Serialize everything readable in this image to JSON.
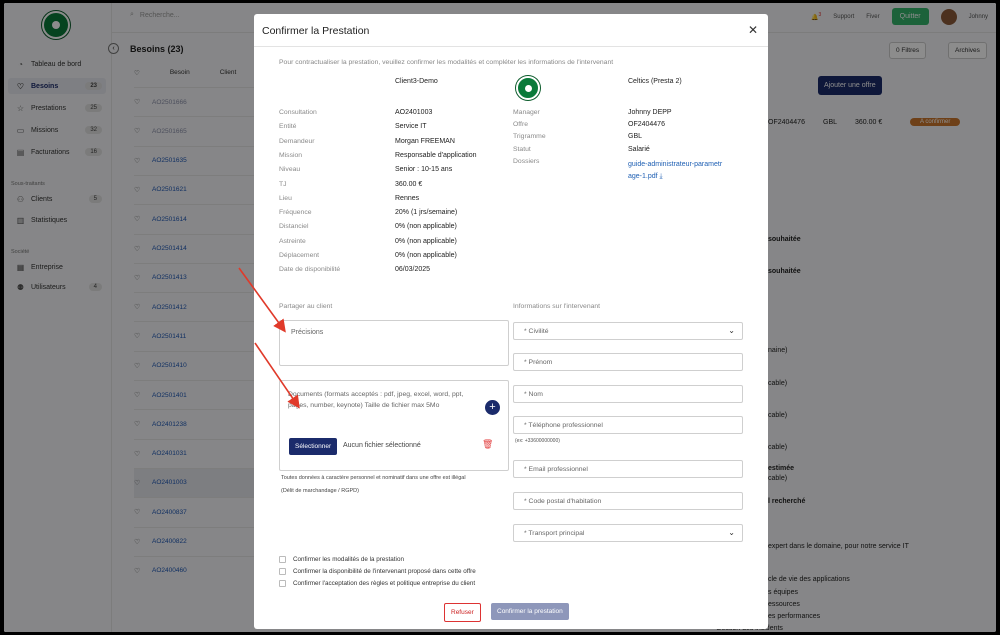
{
  "sidebar": {
    "items": [
      {
        "label": "Tableau de bord",
        "count": "",
        "icon": "dashboard-icon"
      },
      {
        "label": "Besoins",
        "count": "23",
        "icon": "heart-icon"
      },
      {
        "label": "Prestations",
        "count": "25",
        "icon": "star-icon"
      },
      {
        "label": "Missions",
        "count": "32",
        "icon": "briefcase-icon"
      },
      {
        "label": "Facturations",
        "count": "16",
        "icon": "invoice-icon"
      }
    ],
    "section_soustraitants": "Sous-traitants",
    "sub_items": [
      {
        "label": "Clients",
        "count": "5",
        "icon": "users-icon"
      },
      {
        "label": "Statistiques",
        "count": "",
        "icon": "chart-icon"
      }
    ],
    "section_societe": "Société",
    "soc_items": [
      {
        "label": "Entreprise",
        "count": "",
        "icon": "building-icon"
      },
      {
        "label": "Utilisateurs",
        "count": "4",
        "icon": "user-icon"
      }
    ]
  },
  "topbar": {
    "search_placeholder": "Recherche...",
    "notif_count": "3",
    "support": "Support",
    "fiver": "Fiver",
    "quit": "Quitter",
    "user": "Johnny"
  },
  "list": {
    "title": "Besoins (23)",
    "col_besoin": "Besoin",
    "col_client": "Client",
    "rows": [
      "AO2501666",
      "AO2501665",
      "AO2501635",
      "AO2501621",
      "AO2501614",
      "AO2501414",
      "AO2501413",
      "AO2501412",
      "AO2501411",
      "AO2501410",
      "AO2501401",
      "AO2401238",
      "AO2401031",
      "AO2401003",
      "AO2400837",
      "AO2400822",
      "AO2400460"
    ]
  },
  "background": {
    "filters": "0 Filtres",
    "archives": "Archives",
    "add_offer": "Ajouter une offre",
    "offer_id": "OF2404476",
    "trigram": "GBL",
    "amount": "360.00 €",
    "status": "A confirmer",
    "snip1": "souhaitée",
    "snip2": "souhaitée",
    "snip3": "naine)",
    "snip4": "cable)",
    "snip5": "cable)",
    "snip6": "cable)",
    "snip7": "cable)",
    "snip8": "estimée",
    "snip9": "l recherché",
    "snip10": "expert dans le domaine, pour notre service IT",
    "snip11": "cle de vie des applications",
    "snip12": "s équipes",
    "snip13": "essources",
    "snip14": "es performances",
    "snip15": "Gestion des incidents"
  },
  "modal": {
    "title": "Confirmer la Prestation",
    "intro": "Pour contractualiser la prestation, veuillez confirmer les modalités et compléter les informations de l'intervenant",
    "client_name": "Client3-Demo",
    "company_name": "Celtics (Presta 2)",
    "left_labels": [
      "Consultation",
      "Entité",
      "Demandeur",
      "Mission",
      "Niveau",
      "TJ",
      "Lieu",
      "Fréquence",
      "Distanciel",
      "Astreinte",
      "Déplacement",
      "Date de disponibilité"
    ],
    "left_values": [
      "AO2401003",
      "Service IT",
      "Morgan FREEMAN",
      "Responsable d'application",
      "Senior : 10-15 ans",
      "360.00 €",
      "Rennes",
      "20% (1 jrs/semaine)",
      "0% (non applicable)",
      "0% (non applicable)",
      "0% (non applicable)",
      "06/03/2025"
    ],
    "right_labels": [
      "Manager",
      "Offre",
      "Trigramme",
      "Statut",
      "Dossiers"
    ],
    "right_values": [
      "Johnny DEPP",
      "OF2404476",
      "GBL",
      "Salarié"
    ],
    "file_link_1": "guide-administrateur-parametr",
    "file_link_2": "age-1.pdf",
    "share_title": "Partager au client",
    "precisions_placeholder": "Précisions",
    "documents_text": "Documents (formats acceptés : pdf, jpeg, excel, word, ppt, pages, number, keynote) Taille de fichier max 5Mo",
    "select_button": "Sélectionner",
    "no_file": "Aucun fichier sélectionné",
    "legal_1": "Toutes données à caractère personnel et nominatif dans une offre est illégal",
    "legal_2": "(Délit de marchandage / RGPD)",
    "info_title": "Informations sur l'intervenant",
    "fields": {
      "civilite": "* Civilité",
      "prenom": "* Prénom",
      "nom": "* Nom",
      "telephone": "* Téléphone professionnel",
      "phone_hint": "(ex: +33600000000)",
      "email": "* Email professionnel",
      "postal": "* Code postal d'habitation",
      "transport": "* Transport principal"
    },
    "checks": [
      "Confirmer les modalités de la prestation",
      "Confirmer la disponibilité de l'intervenant proposé dans cette offre",
      "Confirmer l'acceptation des règles et politique entreprise du client"
    ],
    "refuse": "Refuser",
    "confirm": "Confirmer la prestation"
  },
  "colors": {
    "primary": "#1b2b6b",
    "arrow": "#e03a2a",
    "confirm_disabled": "#8e97ba",
    "refuse": "#d33333"
  }
}
